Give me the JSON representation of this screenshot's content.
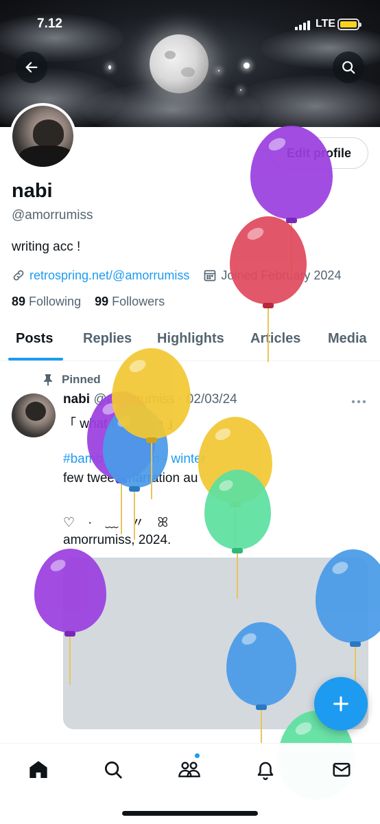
{
  "status_bar": {
    "time": "7.12",
    "network": "LTE"
  },
  "profile": {
    "edit_profile_label": "Edit profile",
    "display_name": "nabi",
    "handle": "@amorrumiss",
    "bio": "writing acc !",
    "link": "retrospring.net/@amorrumiss",
    "joined": "Joined February 2024",
    "following_count": "89",
    "following_label": "Following",
    "followers_count": "99",
    "followers_label": "Followers"
  },
  "tabs": [
    {
      "label": "Posts",
      "active": true
    },
    {
      "label": "Replies"
    },
    {
      "label": "Highlights"
    },
    {
      "label": "Articles"
    },
    {
      "label": "Media"
    }
  ],
  "post": {
    "pinned_label": "Pinned",
    "author_name": "nabi",
    "author_handle_date": "@amorrumiss · 02/03/24",
    "lines": [
      "「 what I've been 」",
      "#bambyongchan - winter",
      "few tweets narration au",
      "♡　·　﹏　〃　ꕤ",
      "amorrumiss, 2024."
    ]
  },
  "icons": {
    "back": "arrow-left-icon",
    "search": "search-icon",
    "link": "link-icon",
    "calendar": "calendar-icon",
    "pin": "pin-icon",
    "more": "more-icon",
    "compose": "plus-icon",
    "nav": [
      "home-icon",
      "search-icon",
      "communities-icon",
      "bell-icon",
      "mail-icon"
    ]
  },
  "colors": {
    "accent": "#1d9bf0",
    "text_primary": "#0f1419",
    "text_secondary": "#536471",
    "balloon_purple": "#9b3fe0",
    "balloon_red": "#e04a5e",
    "balloon_yellow": "#f2c834",
    "balloon_blue": "#4a9be8",
    "balloon_green": "#5ee0a0"
  }
}
